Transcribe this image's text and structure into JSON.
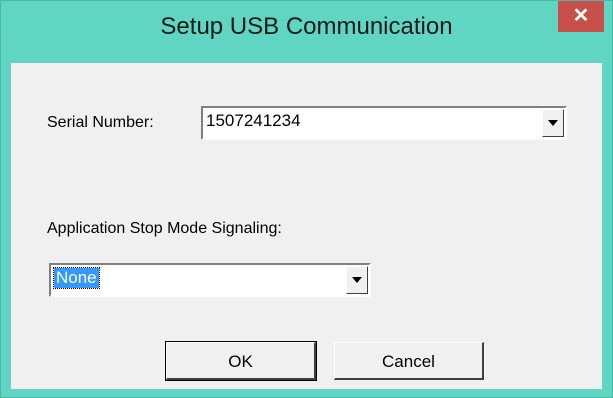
{
  "window": {
    "title": "Setup USB Communication",
    "close_glyph": "✕"
  },
  "serial": {
    "label": "Serial Number:",
    "value": "1507241234"
  },
  "stop_mode": {
    "label": "Application Stop Mode Signaling:",
    "value": "None"
  },
  "buttons": {
    "ok_label": "OK",
    "cancel_label": "Cancel"
  },
  "colors": {
    "title_bar": "#5fd5c2",
    "close_button": "#c7514a",
    "selection": "#3399ff",
    "dialog_face": "#f0f0f0"
  }
}
